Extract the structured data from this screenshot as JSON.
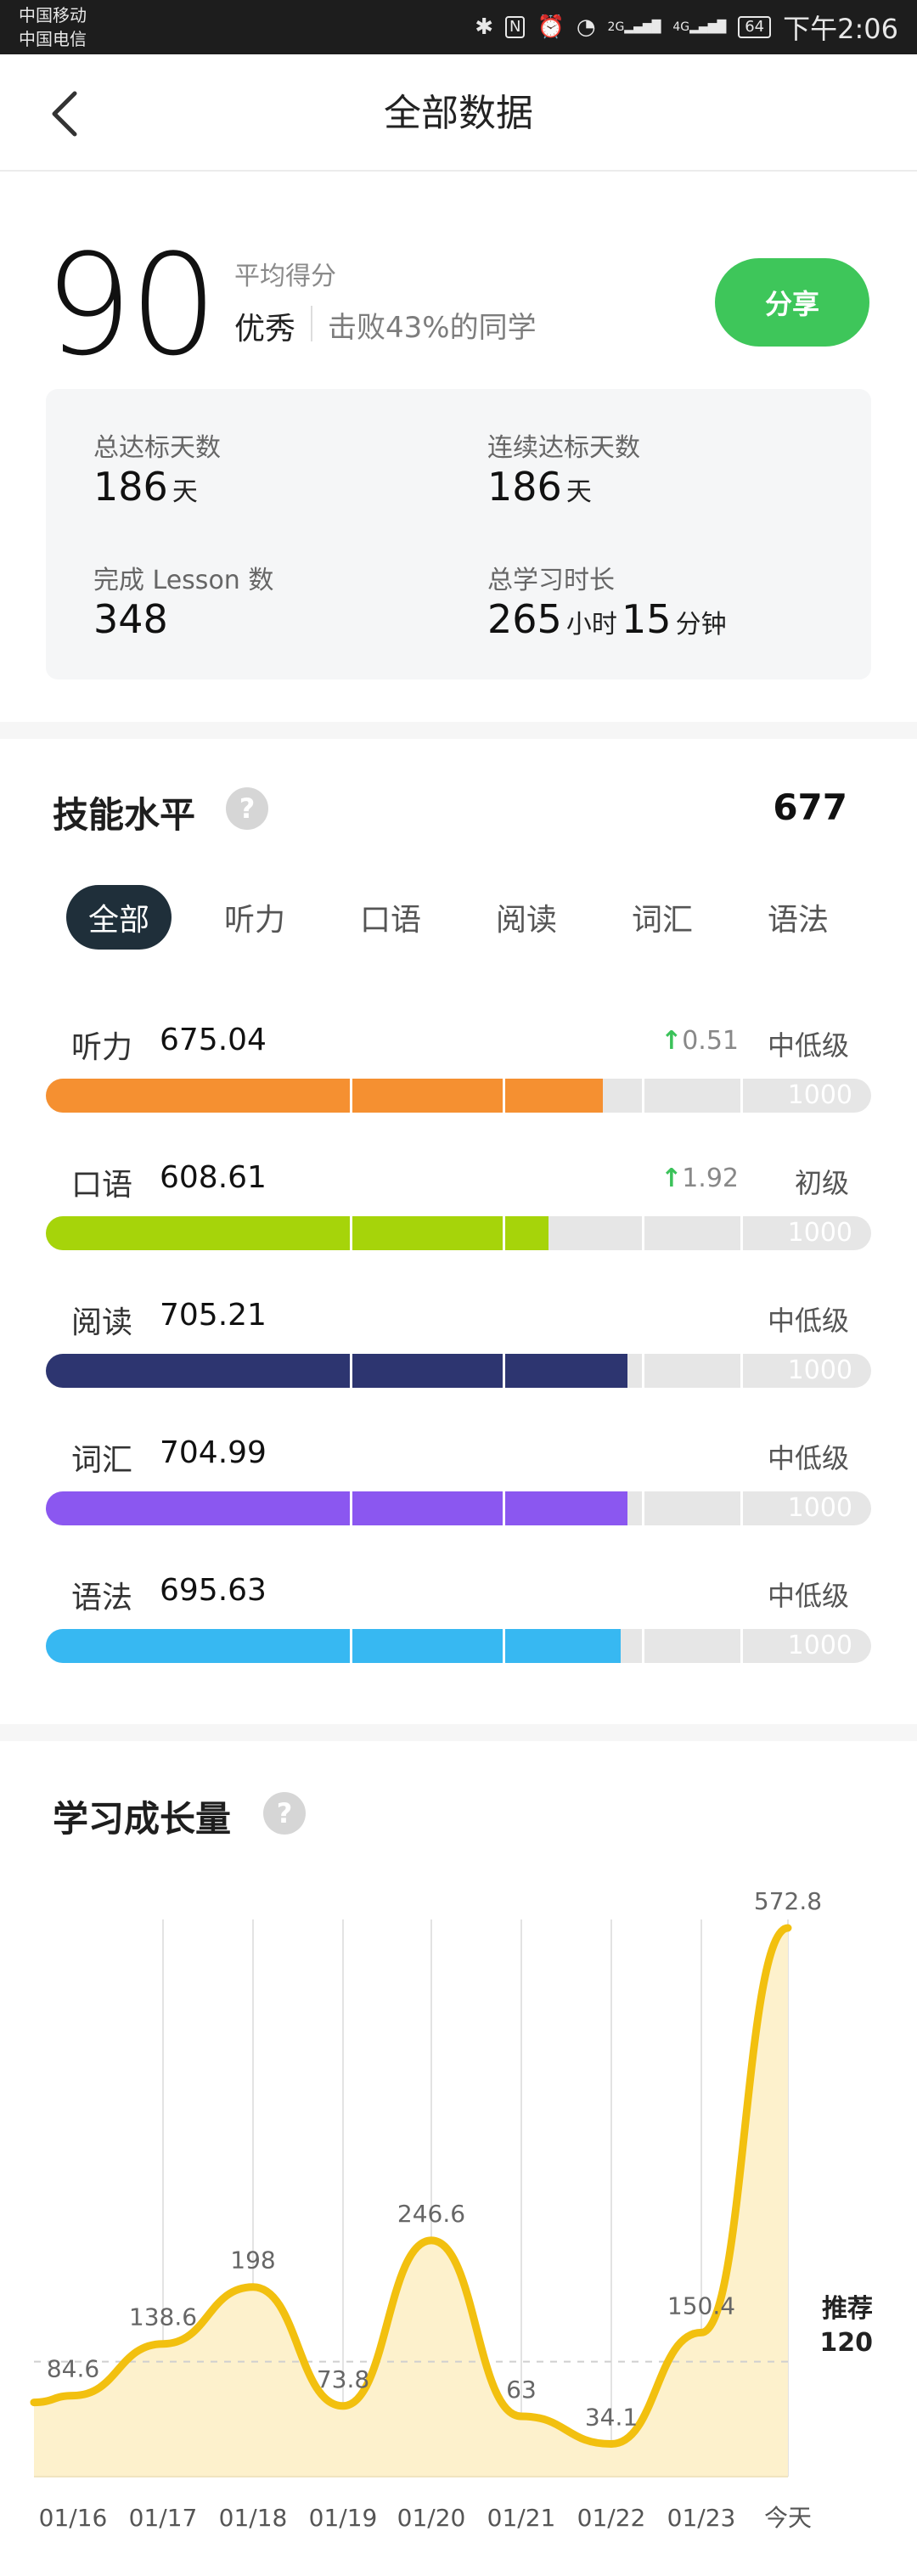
{
  "status_bar": {
    "carrier_1": "中国移动",
    "carrier_2": "中国电信",
    "signal_1": "2G",
    "signal_2": "4G",
    "battery": "64",
    "time": "下午2:06"
  },
  "nav": {
    "title": "全部数据"
  },
  "summary": {
    "score": "90",
    "score_label": "平均得分",
    "grade": "优秀",
    "beat_text": "击败43%的同学",
    "share_label": "分享"
  },
  "stats": {
    "total_days_label": "总达标天数",
    "total_days_value": "186",
    "total_days_unit": "天",
    "streak_label": "连续达标天数",
    "streak_value": "186",
    "streak_unit": "天",
    "lessons_label": "完成 Lesson 数",
    "lessons_value": "348",
    "time_label": "总学习时长",
    "time_hours": "265",
    "time_hours_unit": "小时",
    "time_minutes": "15",
    "time_minutes_unit": "分钟"
  },
  "skills": {
    "title": "技能水平",
    "help": "?",
    "total": "677",
    "tabs": [
      "全部",
      "听力",
      "口语",
      "阅读",
      "词汇",
      "语法"
    ],
    "active_tab": 0,
    "bar_max_label": "1000",
    "items": [
      {
        "name": "听力",
        "score": "675.04",
        "delta": "0.51",
        "level": "中低级",
        "fraction": 0.675,
        "color": "#f59031"
      },
      {
        "name": "口语",
        "score": "608.61",
        "delta": "1.92",
        "level": "初级",
        "fraction": 0.609,
        "color": "#a6d40a"
      },
      {
        "name": "阅读",
        "score": "705.21",
        "delta": "",
        "level": "中低级",
        "fraction": 0.705,
        "color": "#2d3570"
      },
      {
        "name": "词汇",
        "score": "704.99",
        "delta": "",
        "level": "中低级",
        "fraction": 0.705,
        "color": "#8b57f0"
      },
      {
        "name": "语法",
        "score": "695.63",
        "delta": "",
        "level": "中低级",
        "fraction": 0.696,
        "color": "#37b8f2"
      }
    ]
  },
  "growth": {
    "title": "学习成长量",
    "help": "?",
    "recommend_label": "推荐",
    "recommend_value": "120"
  },
  "chart_data": {
    "type": "area",
    "title": "学习成长量",
    "categories": [
      "01/16",
      "01/17",
      "01/18",
      "01/19",
      "01/20",
      "01/21",
      "01/22",
      "01/23",
      "今天"
    ],
    "values": [
      84.6,
      138.6,
      198,
      73.8,
      246.6,
      63,
      34.1,
      150.4,
      572.8
    ],
    "value_labels": [
      "84.6",
      "138.6",
      "198",
      "73.8",
      "246.6",
      "63",
      "34.1",
      "150.4",
      "572.8"
    ],
    "reference_line": 120,
    "line_color": "#f2c00f",
    "fill_color": "#fdf1cc",
    "grid": true
  }
}
